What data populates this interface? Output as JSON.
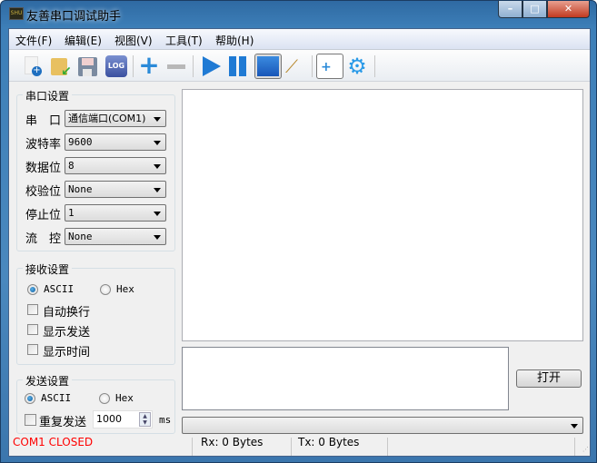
{
  "window": {
    "title": "友善串口调试助手",
    "app_icon": "SHU",
    "minimize": "–",
    "maximize": "□",
    "close": "✕"
  },
  "menu": [
    {
      "label": "文件(F)"
    },
    {
      "label": "编辑(E)"
    },
    {
      "label": "视图(V)"
    },
    {
      "label": "工具(T)"
    },
    {
      "label": "帮助(H)"
    }
  ],
  "toolbar": {
    "log_label": "LOG"
  },
  "serial": {
    "title": "串口设置",
    "fields": [
      {
        "label": "串　口",
        "value": "通信端口(COM1)"
      },
      {
        "label": "波特率",
        "value": "9600"
      },
      {
        "label": "数据位",
        "value": "8"
      },
      {
        "label": "校验位",
        "value": "None"
      },
      {
        "label": "停止位",
        "value": "1"
      },
      {
        "label": "流　控",
        "value": "None"
      }
    ]
  },
  "receive": {
    "title": "接收设置",
    "ascii": "ASCII",
    "hex": "Hex",
    "mode": "ASCII",
    "options": [
      {
        "label": "自动换行",
        "checked": false
      },
      {
        "label": "显示发送",
        "checked": false
      },
      {
        "label": "显示时间",
        "checked": false
      }
    ]
  },
  "send": {
    "title": "发送设置",
    "ascii": "ASCII",
    "hex": "Hex",
    "mode": "ASCII",
    "repeat_label": "重复发送",
    "repeat_checked": false,
    "interval": "1000",
    "unit": "ms"
  },
  "open_button": "打开",
  "status": {
    "port": "COM1 CLOSED",
    "rx": "Rx: 0 Bytes",
    "tx": "Tx: 0 Bytes",
    "port_color": "#ff0000"
  }
}
